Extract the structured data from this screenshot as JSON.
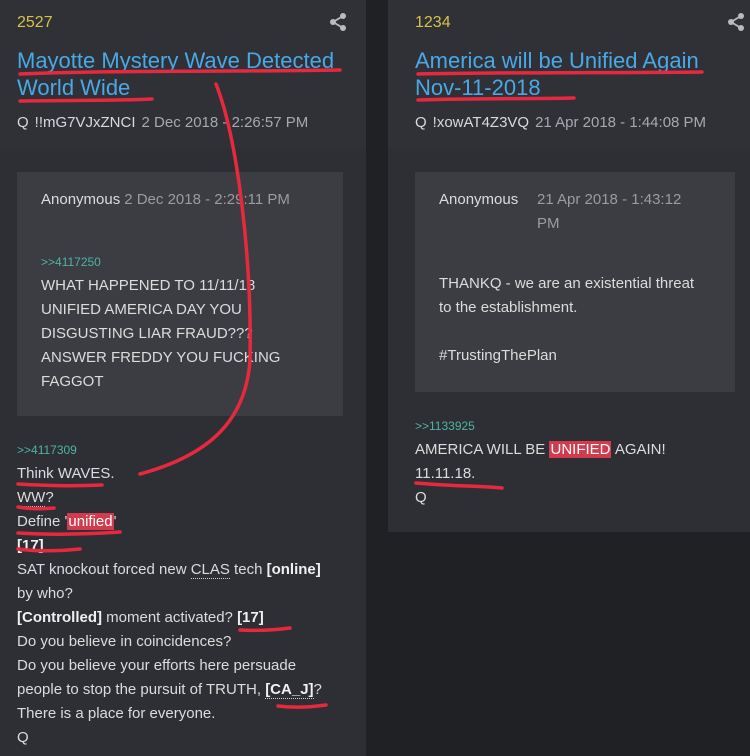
{
  "left_post": {
    "number": "2527",
    "title_line1": "Mayotte Mystery Wave Detected",
    "title_line2": "World Wide",
    "author": "Q",
    "tripcode": "!!mG7VJxZNCI",
    "datetime": "2 Dec 2018 - 2:26:57 PM",
    "quote": {
      "author": "Anonymous",
      "datetime": "2 Dec 2018 - 2:29:11 PM",
      "reply_link": ">>4117250",
      "lines": [
        "WHAT HAPPENED TO 11/11/18",
        "UNIFIED AMERICA DAY YOU",
        "DISGUSTING LIAR FRAUD???",
        "ANSWER FREDDY YOU FUCKING",
        "FAGGOT"
      ]
    },
    "reply_link": ">>4117309",
    "body": {
      "think_prefix": "Think ",
      "think_word": "WAVES",
      "think_suffix": ".",
      "ww": "WW",
      "ww_suffix": "?",
      "define_prefix": "Define '",
      "define_word": "unified",
      "define_suffix": "'",
      "num17": "[17]",
      "sat_prefix": "SAT knockout forced new ",
      "sat_clas": "CLAS",
      "sat_mid": " tech ",
      "sat_online": "[online]",
      "by_who": "by who?",
      "controlled": "[Controlled]",
      "moment": " moment activated? ",
      "num17b": "[17]",
      "coincidences": "Do you believe in coincidences?",
      "efforts": "Do you believe your efforts here persuade",
      "pursuit_prefix": "people to stop the pursuit of TRUTH, ",
      "ca_j": "[CA_J]",
      "pursuit_suffix": "?",
      "place": "There is a place for everyone.",
      "sign": "Q"
    }
  },
  "right_post": {
    "number": "1234",
    "title_line1": "America will be Unified Again",
    "title_line2": "Nov-11-2018",
    "author": "Q",
    "tripcode": "!xowAT4Z3VQ",
    "datetime": "21 Apr 2018 - 1:44:08 PM",
    "quote": {
      "author": "Anonymous",
      "datetime_line1": "21 Apr 2018 - 1:43:12",
      "datetime_line2": "PM",
      "lines": [
        "THANKQ - we are an existential threat",
        "to the establishment."
      ],
      "hashtag": "#TrustingThePlan"
    },
    "reply_link": ">>1133925",
    "body": {
      "line1_prefix": "AMERICA WILL BE ",
      "line1_highlight": "UNIFIED",
      "line1_suffix": " AGAIN!",
      "date": "11.11.18.",
      "sign": "Q"
    }
  },
  "colors": {
    "background": "#1f2125",
    "panel": "#2d2f34",
    "title_link": "#4aa8e6",
    "post_number": "#d6c24a",
    "highlight": "#d23b4e",
    "annotation": "#e8283f"
  },
  "icons": [
    "share-icon"
  ]
}
